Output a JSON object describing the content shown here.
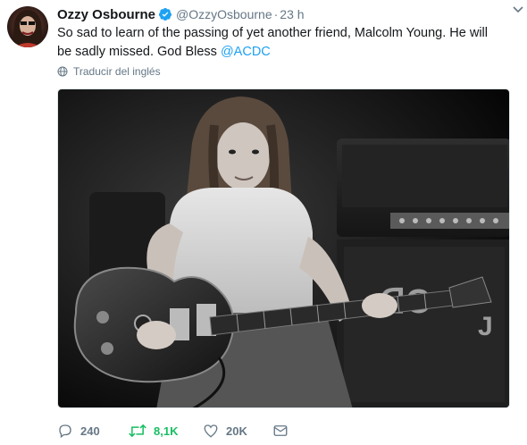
{
  "tweet": {
    "author_name": "Ozzy Osbourne",
    "author_handle": "@OzzyOsbourne",
    "separator": "·",
    "time": "23 h",
    "text_main": "So sad to learn of the passing of yet another friend, Malcolm Young. He will be sadly missed. God Bless ",
    "mention": "@ACDC",
    "translate_label": "Traducir del inglés",
    "media_alt": "Black and white photo of Malcolm Young playing a Gretsch guitar in front of amplifiers"
  },
  "actions": {
    "reply_count": "240",
    "retweet_count": "8,1K",
    "like_count": "20K"
  },
  "colors": {
    "link": "#1da1f2",
    "retweet_active": "#17bf63",
    "muted": "#657786",
    "text": "#14171a"
  },
  "icons": [
    "verified-badge-icon",
    "caret-down-icon",
    "globe-icon",
    "reply-icon",
    "retweet-icon",
    "like-icon",
    "direct-message-icon"
  ]
}
